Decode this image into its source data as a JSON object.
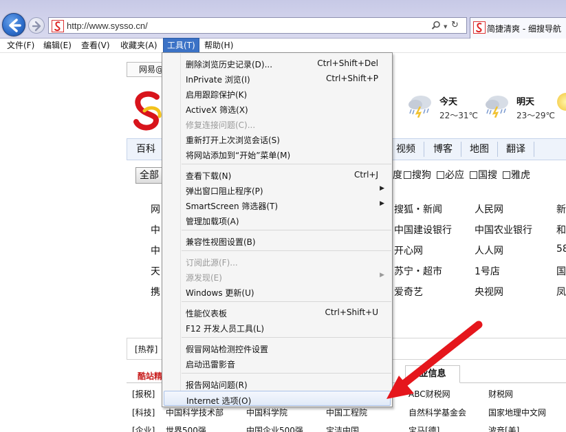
{
  "browser": {
    "url": "http://www.sysso.cn/",
    "tab_title": "简捷清爽 - 细搜导航",
    "accent_color": "#3b72c6"
  },
  "menubar": {
    "file": "文件(F)",
    "edit": "编辑(E)",
    "view": "查看(V)",
    "favorites": "收藏夹(A)",
    "tools": "工具(T)",
    "help": "帮助(H)"
  },
  "tools_menu": {
    "items": [
      {
        "label": "删除浏览历史记录(D)...",
        "shortcut": "Ctrl+Shift+Del"
      },
      {
        "label": "InPrivate 浏览(I)",
        "shortcut": "Ctrl+Shift+P"
      },
      {
        "label": "启用跟踪保护(K)",
        "shortcut": ""
      },
      {
        "label": "ActiveX 筛选(X)",
        "shortcut": ""
      },
      {
        "label": "修复连接问题(C)...",
        "shortcut": "",
        "disabled": true
      },
      {
        "label": "重新打开上次浏览会话(S)",
        "shortcut": ""
      },
      {
        "label": "将网站添加到“开始”菜单(M)",
        "shortcut": ""
      },
      {
        "label": "查看下载(N)",
        "shortcut": "Ctrl+J"
      },
      {
        "label": "弹出窗口阻止程序(P)",
        "shortcut": "",
        "submenu": true
      },
      {
        "label": "SmartScreen 筛选器(T)",
        "shortcut": "",
        "submenu": true
      },
      {
        "label": "管理加载项(A)",
        "shortcut": ""
      },
      {
        "label": "兼容性视图设置(B)",
        "shortcut": ""
      },
      {
        "label": "订阅此源(F)...",
        "shortcut": "",
        "disabled": true
      },
      {
        "label": "源发现(E)",
        "shortcut": "",
        "disabled": true,
        "submenu": true
      },
      {
        "label": "Windows 更新(U)",
        "shortcut": ""
      },
      {
        "label": "性能仪表板",
        "shortcut": "Ctrl+Shift+U"
      },
      {
        "label": "F12 开发人员工具(L)",
        "shortcut": ""
      },
      {
        "label": "假冒网站检测控件设置",
        "shortcut": ""
      },
      {
        "label": "启动迅雷影音",
        "shortcut": ""
      },
      {
        "label": "报告网站问题(R)",
        "shortcut": ""
      },
      {
        "label": "Internet 选项(O)",
        "shortcut": "",
        "highlighted": true
      }
    ]
  },
  "page": {
    "search_select": "网易@",
    "weather": {
      "today_label": "今天",
      "today_temp": "22～31℃",
      "tomorrow_label": "明天",
      "tomorrow_temp": "23～29℃"
    },
    "nav": {
      "baike": "百科",
      "video": "视频",
      "blog": "博客",
      "map": "地图",
      "translate": "翻译"
    },
    "engines": {
      "all": "全部",
      "du": "度",
      "sogou": "搜狗",
      "bing": "必应",
      "guosou": "国搜",
      "yahoo": "雅虎"
    },
    "sites_left_partial": [
      "网",
      "中",
      "中",
      "天",
      "携"
    ],
    "sites": [
      [
        "搜狐・新闻",
        "人民网",
        "新"
      ],
      [
        "中国建设银行",
        "中国农业银行",
        "和"
      ],
      [
        "开心网",
        "人人网",
        "58"
      ],
      [
        "苏宁・超市",
        "1号店",
        "国"
      ],
      [
        "爱奇艺",
        "央视网",
        "凤"
      ]
    ],
    "hot_label": "[热荐]",
    "tab_kuzhan": "酷站精",
    "tab_industry": "业信息",
    "rows": [
      {
        "cat": "[报税]",
        "links": [
          "ABC财税网",
          "财税网"
        ]
      },
      {
        "cat": "[科技]",
        "links": [
          "中国科学技术部",
          "中国科学院",
          "中国工程院",
          "自然科学基金会",
          "国家地理中文网"
        ]
      },
      {
        "cat": "[企业]",
        "links": [
          "世界500强",
          "中国企业500强",
          "宝洁中国",
          "宝马[德]",
          "波音[美]"
        ]
      }
    ]
  }
}
